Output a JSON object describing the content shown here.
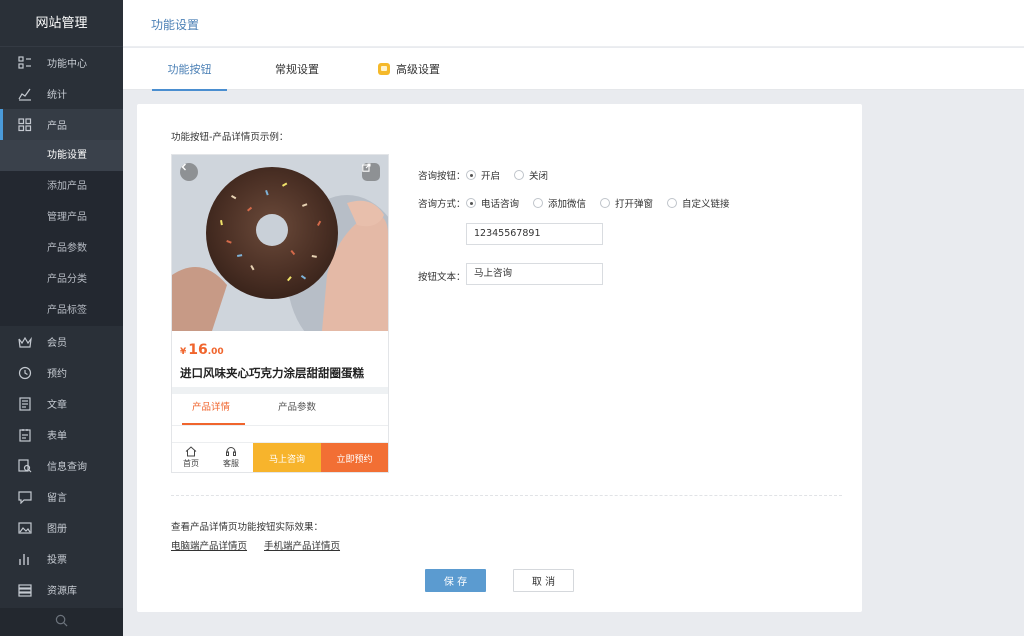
{
  "sidebar": {
    "title": "网站管理",
    "items": [
      {
        "label": "功能中心",
        "icon": "function-center-icon"
      },
      {
        "label": "统计",
        "icon": "stats-icon"
      },
      {
        "label": "产品",
        "icon": "product-icon"
      },
      {
        "label": "会员",
        "icon": "member-icon"
      },
      {
        "label": "预约",
        "icon": "booking-icon"
      },
      {
        "label": "文章",
        "icon": "article-icon"
      },
      {
        "label": "表单",
        "icon": "form-icon"
      },
      {
        "label": "信息查询",
        "icon": "info-search-icon"
      },
      {
        "label": "留言",
        "icon": "message-icon"
      },
      {
        "label": "图册",
        "icon": "album-icon"
      },
      {
        "label": "投票",
        "icon": "vote-icon"
      },
      {
        "label": "资源库",
        "icon": "resource-icon"
      }
    ],
    "sub_items": [
      "功能设置",
      "添加产品",
      "管理产品",
      "产品参数",
      "产品分类",
      "产品标签"
    ]
  },
  "header": {
    "title": "功能设置"
  },
  "tabs": [
    "功能按钮",
    "常规设置",
    "高级设置"
  ],
  "preview": {
    "label": "功能按钮-产品详情页示例：",
    "price_symbol": "¥",
    "price_int": "16",
    "price_dec": ".00",
    "name": "进口风味夹心巧克力涂层甜甜圈蛋糕",
    "tab_detail": "产品详情",
    "tab_params": "产品参数",
    "home": "首页",
    "service": "客服",
    "consult": "马上咨询",
    "book": "立即预约"
  },
  "form": {
    "consult_btn_label": "咨询按钮：",
    "on": "开启",
    "off": "关闭",
    "consult_method_label": "咨询方式：",
    "methods": [
      "电话咨询",
      "添加微信",
      "打开弹窗",
      "自定义链接"
    ],
    "phone_value": "12345567891",
    "btn_text_label": "按钮文本：",
    "btn_text_value": "马上咨询"
  },
  "footer": {
    "note": "查看产品详情页功能按钮实际效果：",
    "pc_link": "电脑端产品详情页",
    "mobile_link": "手机端产品详情页",
    "save": "保 存",
    "cancel": "取 消"
  },
  "colors": {
    "accent": "#4a8ed0",
    "orange": "#f26f34",
    "yellow": "#f7b42c",
    "sidebar": "#2a3038"
  }
}
